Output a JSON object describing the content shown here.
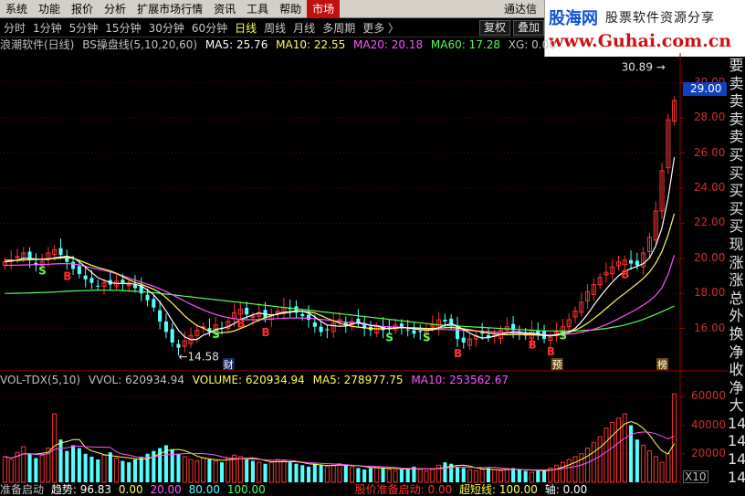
{
  "menubar": {
    "items": [
      "系统",
      "功能",
      "报价",
      "分析",
      "扩展市场行情",
      "资讯",
      "工具",
      "帮助"
    ],
    "active_item": "市场",
    "right_item": "通达信"
  },
  "periodbar": {
    "items": [
      "分时",
      "1分钟",
      "5分钟",
      "15分钟",
      "30分钟",
      "60分钟",
      "日线",
      "周线",
      "月线",
      "多周期",
      "更多 〉"
    ],
    "selected_index": 6,
    "btn_restore": "复权",
    "btn_overlay": "叠加"
  },
  "logo": {
    "brand": "股海网",
    "slogan": "股票软件资源分享",
    "url": "www.Guhai.com.cn"
  },
  "infobar": {
    "stock": "浪潮软件(日线)",
    "indicator": "BS操盘线(5,10,20,60)",
    "ma5": "MA5: 25.76",
    "ma10": "MA10: 22.55",
    "ma20": "MA20: 20.18",
    "ma60": "MA60: 17.28",
    "xg": "XG: 0.00"
  },
  "colors": {
    "up": "#ff3232",
    "down": "#54ffff",
    "ma5": "#ffffff",
    "ma10": "#ffff54",
    "ma20": "#ff54ff",
    "ma60": "#54ff54",
    "grid": "#7a0000",
    "axis": "#a00000"
  },
  "price_axis": {
    "ticks": [
      "30.00",
      "28.00",
      "26.00",
      "24.00",
      "22.00",
      "20.00",
      "18.00",
      "16.00"
    ],
    "current": "29.00",
    "max_label": "30.89",
    "min_label": "14.58"
  },
  "chart_markers": {
    "fin": "财",
    "pre": "预",
    "bang": "榜"
  },
  "volbar": {
    "name": "VOL-TDX(5,10)",
    "vvol": "VVOL: 620934.94",
    "volume": "VOLUME: 620934.94",
    "ma5": "MA5: 278977.75",
    "ma10": "MA10: 253562.67"
  },
  "vol_axis": {
    "ticks": [
      "60000",
      "40000",
      "20000"
    ],
    "unit": "X10"
  },
  "sidebar": {
    "items": [
      "要",
      "卖",
      "卖",
      "卖",
      "卖",
      "买",
      "买",
      "买",
      "买",
      "买",
      "现",
      "涨",
      "涨",
      "总",
      "外",
      "换",
      "净",
      "收",
      "净",
      "大",
      "14",
      "14",
      "14",
      "14"
    ]
  },
  "bottombar": {
    "item1": "准备启动",
    "item2": "趋势: 96.83",
    "item3": "0.00",
    "item4": "20.00",
    "item5": "80.00",
    "item6": "100.00",
    "item7": "股价准备启动: 0.00",
    "item8": "超短线: 100.00",
    "item9": "轴: 0.00"
  },
  "chart_data": {
    "type": "candlestick",
    "price_range": [
      14,
      31.5
    ],
    "closes": [
      19.8,
      19.9,
      20.1,
      20.3,
      19.9,
      19.6,
      19.8,
      20.3,
      20.5,
      20.2,
      19.8,
      19.4,
      19.1,
      18.8,
      18.6,
      18.4,
      18.6,
      18.5,
      18.7,
      18.6,
      18.5,
      18.3,
      18.0,
      17.6,
      17.2,
      16.4,
      15.8,
      15.2,
      14.9,
      15.3,
      15.6,
      15.9,
      16.1,
      15.8,
      16.2,
      16.0,
      16.4,
      16.9,
      17.1,
      16.8,
      16.7,
      16.9,
      16.6,
      16.8,
      17.0,
      17.2,
      17.1,
      16.9,
      16.7,
      16.5,
      16.1,
      15.8,
      15.9,
      16.3,
      16.5,
      16.2,
      16.4,
      16.3,
      16.0,
      15.9,
      16.1,
      15.9,
      16.0,
      16.2,
      16.1,
      15.9,
      15.7,
      15.8,
      16.0,
      16.2,
      16.5,
      16.4,
      16.2,
      15.4,
      15.2,
      15.4,
      15.6,
      15.7,
      15.5,
      15.6,
      15.9,
      16.1,
      15.9,
      15.7,
      15.6,
      15.9,
      15.7,
      15.4,
      15.5,
      15.8,
      16.1,
      16.5,
      17.0,
      17.5,
      18.1,
      18.5,
      18.9,
      19.2,
      19.5,
      19.8,
      19.9,
      19.7,
      19.6,
      20.3,
      21.2,
      22.7,
      25.0,
      27.9,
      29.0
    ],
    "volumes": [
      18000,
      16000,
      21000,
      25000,
      20000,
      17000,
      19000,
      24000,
      48000,
      30000,
      22000,
      26000,
      24000,
      20000,
      18000,
      16000,
      19000,
      21000,
      17000,
      15000,
      14000,
      16000,
      18000,
      20000,
      22000,
      24000,
      26000,
      23000,
      20000,
      18000,
      16000,
      15000,
      17000,
      16000,
      15000,
      14000,
      17000,
      19000,
      18000,
      16000,
      15000,
      14000,
      13000,
      14000,
      16000,
      15000,
      14000,
      13000,
      12000,
      11000,
      13000,
      12000,
      11000,
      12000,
      13000,
      12000,
      11000,
      10000,
      9000,
      10000,
      11000,
      10000,
      9000,
      8000,
      9000,
      10000,
      11000,
      9000,
      8000,
      9000,
      12000,
      14000,
      13000,
      11000,
      10000,
      9000,
      8000,
      9000,
      10000,
      9000,
      8000,
      9000,
      10000,
      9000,
      8000,
      7000,
      8000,
      9000,
      10000,
      12000,
      14000,
      16000,
      18000,
      20000,
      24000,
      28000,
      32000,
      38000,
      42000,
      45000,
      48000,
      40000,
      30000,
      26000,
      22000,
      18000,
      14000,
      20000,
      62000
    ],
    "ma5": [
      19.8,
      19.85,
      19.9,
      20.0,
      20.0,
      19.96,
      19.94,
      19.94,
      20.02,
      20.08,
      20.12,
      20.04,
      19.8,
      19.5,
      19.2,
      18.9,
      18.74,
      18.62,
      18.56,
      18.56,
      18.58,
      18.52,
      18.42,
      18.2,
      17.92,
      17.5,
      17.0,
      16.44,
      15.9,
      15.52,
      15.36,
      15.38,
      15.62,
      15.74,
      15.96,
      16.0,
      16.1,
      16.28,
      16.52,
      16.64,
      16.78,
      16.88,
      16.82,
      16.76,
      16.8,
      16.9,
      16.92,
      16.98,
      16.98,
      16.88,
      16.66,
      16.4,
      16.2,
      16.16,
      16.12,
      16.14,
      16.26,
      16.34,
      16.28,
      16.16,
      16.14,
      16.04,
      15.98,
      16.02,
      16.06,
      16.02,
      15.98,
      15.94,
      15.9,
      15.92,
      16.04,
      16.18,
      16.26,
      16.14,
      15.94,
      15.74,
      15.56,
      15.46,
      15.48,
      15.56,
      15.66,
      15.76,
      15.8,
      15.8,
      15.74,
      15.74,
      15.7,
      15.62,
      15.58,
      15.66,
      15.7,
      15.8,
      16.0,
      16.38,
      16.82,
      17.32,
      17.8,
      18.24,
      18.64,
      19.0,
      19.26,
      19.42,
      19.54,
      19.7,
      20.02,
      20.7,
      21.72,
      23.44,
      25.76
    ],
    "ma10": [
      19.9,
      19.88,
      19.88,
      19.9,
      19.92,
      19.94,
      19.95,
      19.97,
      19.99,
      20.02,
      20.04,
      20.0,
      19.88,
      19.74,
      19.6,
      19.48,
      19.38,
      19.28,
      19.14,
      18.96,
      18.78,
      18.62,
      18.52,
      18.38,
      18.24,
      18.04,
      17.76,
      17.44,
      17.08,
      16.72,
      16.42,
      16.16,
      16.02,
      15.84,
      15.74,
      15.76,
      15.78,
      15.86,
      16.0,
      16.14,
      16.32,
      16.48,
      16.62,
      16.72,
      16.84,
      16.92,
      16.96,
      17.0,
      16.98,
      16.94,
      16.88,
      16.74,
      16.58,
      16.44,
      16.3,
      16.2,
      16.12,
      16.08,
      16.04,
      16.0,
      15.98,
      15.98,
      16.0,
      16.02,
      16.04,
      16.04,
      16.04,
      16.02,
      16.0,
      16.0,
      16.02,
      16.04,
      16.06,
      16.02,
      15.98,
      15.92,
      15.86,
      15.8,
      15.74,
      15.7,
      15.66,
      15.64,
      15.66,
      15.66,
      15.64,
      15.64,
      15.62,
      15.6,
      15.58,
      15.62,
      15.7,
      15.78,
      15.9,
      16.08,
      16.3,
      16.56,
      16.84,
      17.14,
      17.44,
      17.74,
      18.0,
      18.28,
      18.56,
      18.86,
      19.22,
      19.72,
      20.38,
      21.34,
      22.55
    ],
    "ma20": [
      19.6,
      19.6,
      19.61,
      19.62,
      19.63,
      19.64,
      19.65,
      19.66,
      19.68,
      19.7,
      19.7,
      19.68,
      19.62,
      19.54,
      19.46,
      19.38,
      19.3,
      19.22,
      19.12,
      19.0,
      18.88,
      18.76,
      18.64,
      18.52,
      18.4,
      18.26,
      18.1,
      17.92,
      17.74,
      17.56,
      17.38,
      17.22,
      17.06,
      16.92,
      16.8,
      16.7,
      16.62,
      16.56,
      16.52,
      16.5,
      16.5,
      16.5,
      16.52,
      16.54,
      16.56,
      16.58,
      16.6,
      16.6,
      16.6,
      16.58,
      16.56,
      16.52,
      16.48,
      16.44,
      16.4,
      16.36,
      16.32,
      16.28,
      16.24,
      16.2,
      16.16,
      16.12,
      16.1,
      16.08,
      16.06,
      16.04,
      16.02,
      16.0,
      15.98,
      15.96,
      15.95,
      15.94,
      15.93,
      15.92,
      15.9,
      15.88,
      15.86,
      15.84,
      15.82,
      15.8,
      15.78,
      15.76,
      15.74,
      15.72,
      15.7,
      15.68,
      15.66,
      15.64,
      15.62,
      15.62,
      15.64,
      15.68,
      15.72,
      15.78,
      15.86,
      15.96,
      16.08,
      16.22,
      16.38,
      16.56,
      16.74,
      16.92,
      17.12,
      17.34,
      17.58,
      17.88,
      18.32,
      19.08,
      20.18
    ],
    "ma60": [
      18.0,
      18.0,
      18.01,
      18.02,
      18.03,
      18.04,
      18.05,
      18.06,
      18.08,
      18.1,
      18.12,
      18.14,
      18.15,
      18.16,
      18.17,
      18.18,
      18.18,
      18.18,
      18.17,
      18.16,
      18.14,
      18.12,
      18.1,
      18.07,
      18.04,
      18.0,
      17.96,
      17.92,
      17.88,
      17.84,
      17.8,
      17.76,
      17.72,
      17.68,
      17.64,
      17.6,
      17.56,
      17.52,
      17.48,
      17.44,
      17.4,
      17.36,
      17.32,
      17.28,
      17.24,
      17.2,
      17.16,
      17.12,
      17.08,
      17.04,
      17.0,
      16.96,
      16.92,
      16.88,
      16.84,
      16.8,
      16.76,
      16.72,
      16.68,
      16.64,
      16.6,
      16.56,
      16.52,
      16.48,
      16.44,
      16.4,
      16.36,
      16.32,
      16.28,
      16.24,
      16.2,
      16.18,
      16.16,
      16.14,
      16.12,
      16.1,
      16.08,
      16.06,
      16.04,
      16.02,
      16.0,
      15.98,
      15.96,
      15.94,
      15.92,
      15.9,
      15.88,
      15.86,
      15.86,
      15.86,
      15.86,
      15.86,
      15.86,
      15.88,
      15.9,
      15.92,
      15.96,
      16.0,
      16.06,
      16.12,
      16.2,
      16.3,
      16.4,
      16.52,
      16.66,
      16.8,
      16.96,
      17.12,
      17.28
    ]
  }
}
